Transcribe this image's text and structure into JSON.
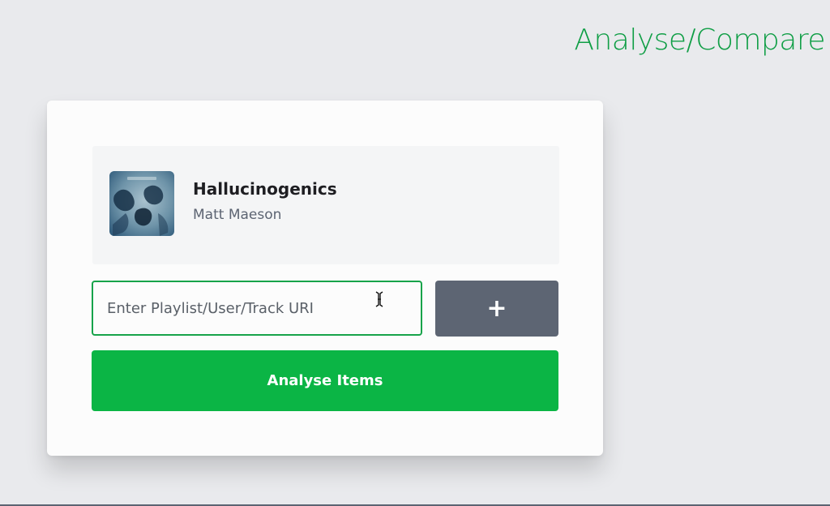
{
  "header": {
    "title": "Analyse/Compare"
  },
  "selected_items": [
    {
      "title": "Hallucinogenics",
      "artist": "Matt Maeson",
      "art_icon": "album-cover-image"
    }
  ],
  "input": {
    "placeholder": "Enter Playlist/User/Track URI",
    "value": ""
  },
  "buttons": {
    "add_label": "+",
    "analyse_label": "Analyse Items"
  },
  "colors": {
    "accent_green": "#0bb545",
    "title_green": "#0f9e45",
    "input_border": "#17a34a",
    "add_button": "#5d6573",
    "artist_text": "#5c6472"
  }
}
